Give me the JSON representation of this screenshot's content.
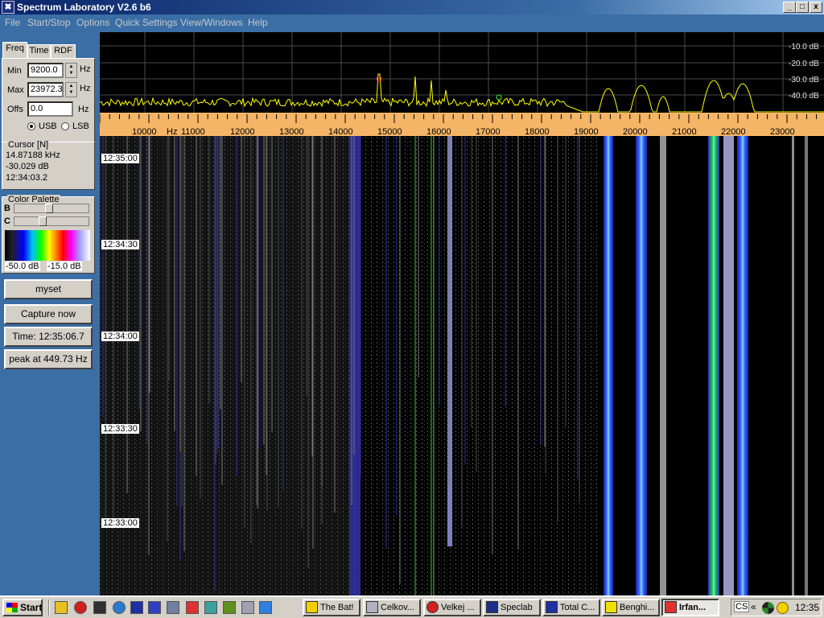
{
  "window": {
    "title": "Spectrum Laboratory V2.6 b6",
    "min_btn": "_",
    "max_btn": "□",
    "close_btn": "x"
  },
  "menu": [
    "File",
    "Start/Stop",
    "Options",
    "Quick Settings",
    "View/Windows",
    "Help"
  ],
  "tabs": [
    "Freq",
    "Time",
    "RDF"
  ],
  "freq": {
    "min_label": "Min",
    "min_value": "9200.0",
    "min_unit": "Hz",
    "max_label": "Max",
    "max_value": "23972.3",
    "max_unit": "Hz",
    "offs_label": "Offs",
    "offs_value": "0.0",
    "offs_unit": "Hz",
    "usb": "USB",
    "lsb": "LSB",
    "usb_selected": true
  },
  "cursor": {
    "label": "Cursor [N]",
    "freq": "14.87188 kHz",
    "level": "-30.029 dB",
    "time": "12:34:03.2"
  },
  "palette": {
    "label": "Color Palette",
    "b": "B",
    "c": "C",
    "min_db": "-50.0 dB",
    "max_db": "-15.0 dB"
  },
  "buttons": {
    "myset": "myset",
    "capture": "Capture now",
    "time": "Time:  12:35:06.7",
    "peak": "peak at 449.73 Hz"
  },
  "spectrum": {
    "db_labels": [
      "-10.0 dB",
      "-20.0 dB",
      "-30.0 dB",
      "-40.0 dB"
    ]
  },
  "freq_scale": {
    "hz_label": "Hz",
    "labels": [
      "10000",
      "11000",
      "12000",
      "13000",
      "14000",
      "15000",
      "16000",
      "17000",
      "18000",
      "19000",
      "20000",
      "21000",
      "22000",
      "23000"
    ]
  },
  "waterfall": {
    "time_labels": [
      "12:35:00",
      "12:34:30",
      "12:34:00",
      "12:33:30",
      "12:33:00"
    ]
  },
  "taskbar": {
    "start": "Start",
    "tasks": [
      "The Bat!",
      "Celkov...",
      "Velkej ...",
      "Speclab",
      "Total C...",
      "Benghi...",
      "Irfan..."
    ],
    "tray_cs": "CS",
    "tray_arrows": "«",
    "clock": "12:35"
  },
  "colors": {
    "titlebar_start": "#0a246a",
    "panel_bg": "#3a6ea5",
    "scale_bg": "#f5b566",
    "spectrum_trace": "#ffff00"
  }
}
